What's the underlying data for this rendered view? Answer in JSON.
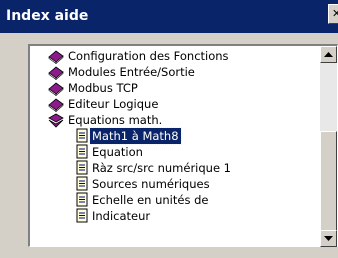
{
  "window": {
    "title": "Index aide",
    "title_color": "#0a246a"
  },
  "tree": {
    "items": [
      {
        "label": "Configuration des Fonctions",
        "icon": "book-icon",
        "level": 0
      },
      {
        "label": "Modules Entrée/Sortie",
        "icon": "book-icon",
        "level": 0
      },
      {
        "label": "Modbus TCP",
        "icon": "book-icon",
        "level": 0
      },
      {
        "label": "Editeur Logique",
        "icon": "book-icon",
        "level": 0
      },
      {
        "label": "Equations math.",
        "icon": "open-book-icon",
        "level": 0
      },
      {
        "label": "Math1 à Math8",
        "icon": "document-icon",
        "level": 1,
        "selected": true
      },
      {
        "label": "Equation",
        "icon": "document-icon",
        "level": 1
      },
      {
        "label": "Ràz src/src numérique 1",
        "icon": "document-icon",
        "level": 1
      },
      {
        "label": "Sources numériques",
        "icon": "document-icon",
        "level": 1
      },
      {
        "label": "Echelle en unités de",
        "icon": "document-icon",
        "level": 1
      },
      {
        "label": "Indicateur",
        "icon": "document-icon",
        "level": 1
      }
    ]
  },
  "colors": {
    "book": "#8b1a8b",
    "selection": "#0a246a"
  }
}
